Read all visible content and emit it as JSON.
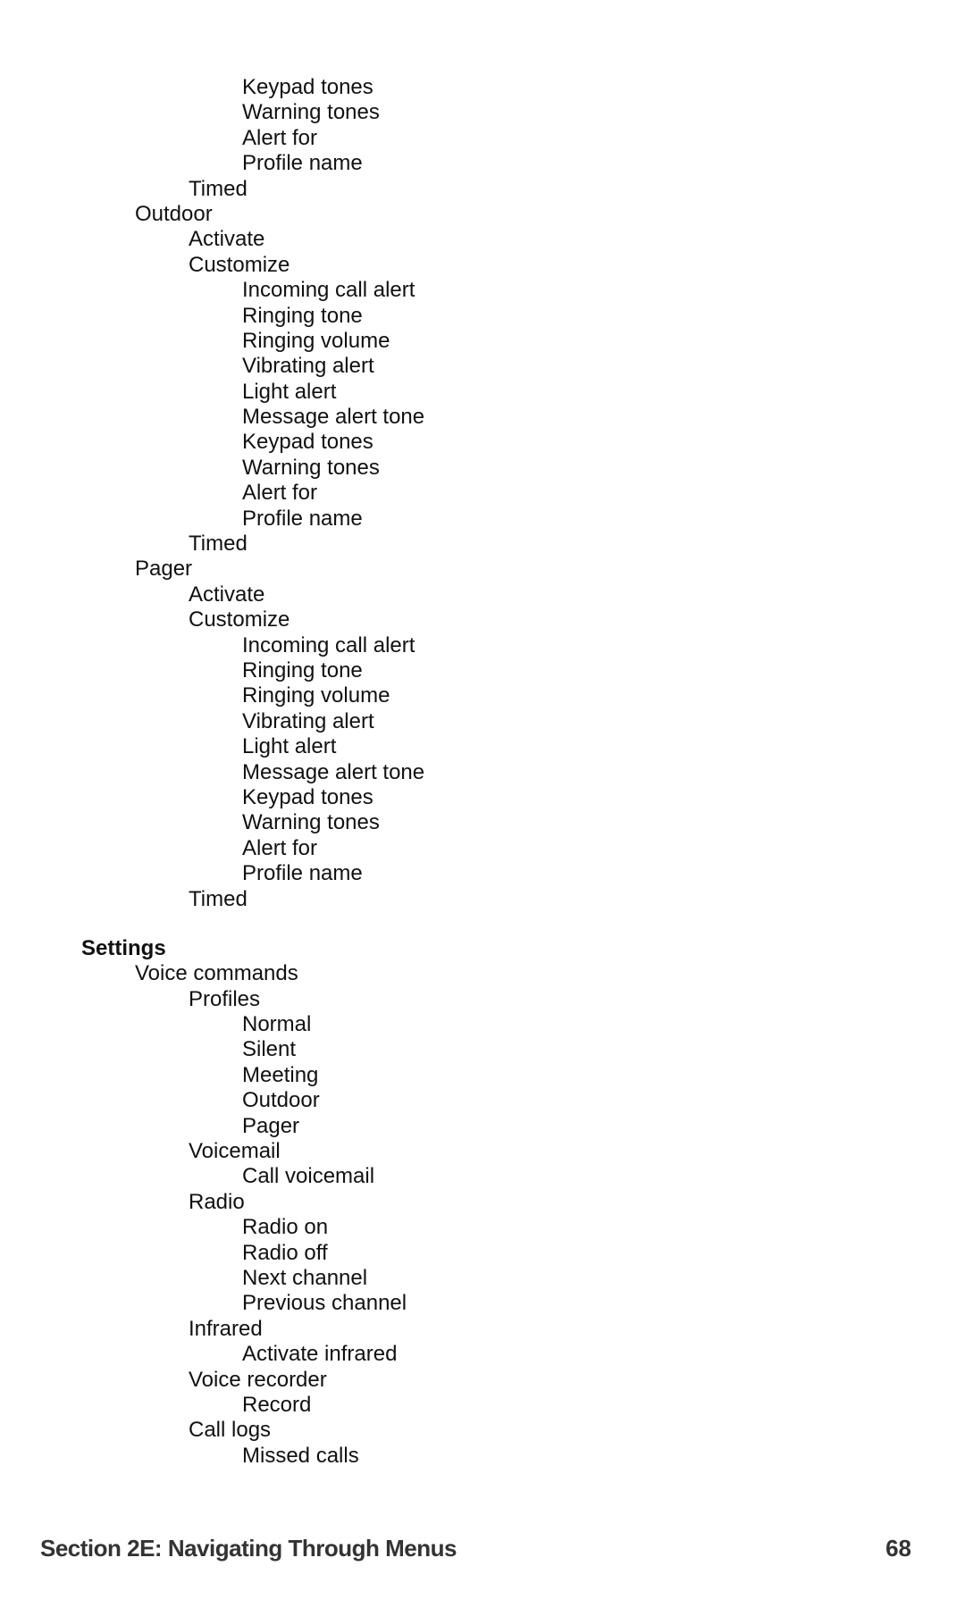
{
  "menu": {
    "continued": [
      {
        "level": 3,
        "label": "Keypad tones"
      },
      {
        "level": 3,
        "label": "Warning tones"
      },
      {
        "level": 3,
        "label": "Alert for"
      },
      {
        "level": 3,
        "label": "Profile name"
      },
      {
        "level": 2,
        "label": "Timed"
      },
      {
        "level": 1,
        "label": "Outdoor"
      },
      {
        "level": 2,
        "label": "Activate"
      },
      {
        "level": 2,
        "label": "Customize"
      },
      {
        "level": 3,
        "label": "Incoming call alert"
      },
      {
        "level": 3,
        "label": "Ringing tone"
      },
      {
        "level": 3,
        "label": "Ringing volume"
      },
      {
        "level": 3,
        "label": "Vibrating alert"
      },
      {
        "level": 3,
        "label": "Light alert"
      },
      {
        "level": 3,
        "label": "Message alert tone"
      },
      {
        "level": 3,
        "label": "Keypad tones"
      },
      {
        "level": 3,
        "label": "Warning tones"
      },
      {
        "level": 3,
        "label": "Alert for"
      },
      {
        "level": 3,
        "label": "Profile name"
      },
      {
        "level": 2,
        "label": "Timed"
      },
      {
        "level": 1,
        "label": "Pager"
      },
      {
        "level": 2,
        "label": "Activate"
      },
      {
        "level": 2,
        "label": "Customize"
      },
      {
        "level": 3,
        "label": "Incoming call alert"
      },
      {
        "level": 3,
        "label": "Ringing tone"
      },
      {
        "level": 3,
        "label": "Ringing volume"
      },
      {
        "level": 3,
        "label": "Vibrating alert"
      },
      {
        "level": 3,
        "label": "Light alert"
      },
      {
        "level": 3,
        "label": "Message alert tone"
      },
      {
        "level": 3,
        "label": "Keypad tones"
      },
      {
        "level": 3,
        "label": "Warning tones"
      },
      {
        "level": 3,
        "label": "Alert for"
      },
      {
        "level": 3,
        "label": "Profile name"
      },
      {
        "level": 2,
        "label": "Timed"
      }
    ],
    "settings": [
      {
        "level": 0,
        "label": "Settings"
      },
      {
        "level": 1,
        "label": "Voice commands"
      },
      {
        "level": 2,
        "label": "Profiles"
      },
      {
        "level": 3,
        "label": "Normal"
      },
      {
        "level": 3,
        "label": "Silent"
      },
      {
        "level": 3,
        "label": "Meeting"
      },
      {
        "level": 3,
        "label": "Outdoor"
      },
      {
        "level": 3,
        "label": "Pager"
      },
      {
        "level": 2,
        "label": "Voicemail"
      },
      {
        "level": 3,
        "label": "Call voicemail"
      },
      {
        "level": 2,
        "label": "Radio"
      },
      {
        "level": 3,
        "label": "Radio on"
      },
      {
        "level": 3,
        "label": "Radio off"
      },
      {
        "level": 3,
        "label": "Next channel"
      },
      {
        "level": 3,
        "label": "Previous channel"
      },
      {
        "level": 2,
        "label": "Infrared"
      },
      {
        "level": 3,
        "label": "Activate infrared"
      },
      {
        "level": 2,
        "label": "Voice recorder"
      },
      {
        "level": 3,
        "label": "Record"
      },
      {
        "level": 2,
        "label": "Call logs"
      },
      {
        "level": 3,
        "label": "Missed calls"
      }
    ]
  },
  "footer": {
    "section_title": "Section 2E: Navigating Through Menus",
    "page_number": "68"
  }
}
